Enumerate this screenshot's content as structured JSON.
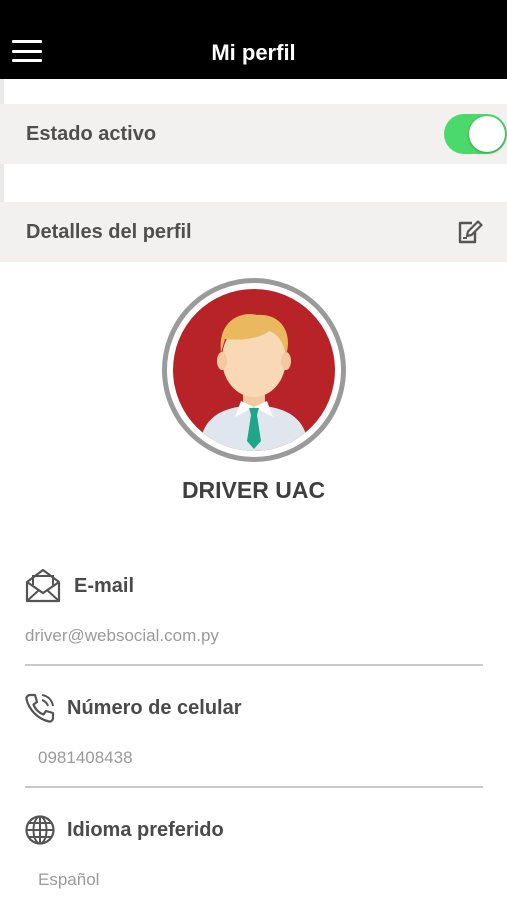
{
  "header": {
    "title": "Mi perfil",
    "menu_icon": "hamburger-icon"
  },
  "status": {
    "label": "Estado activo",
    "active": true,
    "toggle_color": "#4cd96b"
  },
  "profile_section": {
    "label": "Detalles del perfil",
    "edit_icon": "edit-icon"
  },
  "user": {
    "name": "DRIVER UAC",
    "avatar_icon": "user-avatar",
    "avatar_bg": "#b82328"
  },
  "fields": [
    {
      "label": "E-mail",
      "value": "driver@websocial.com.py",
      "icon": "envelope-icon"
    },
    {
      "label": "Número de celular",
      "value": "0981408438",
      "icon": "phone-icon"
    },
    {
      "label": "Idioma preferido",
      "value": "Español",
      "icon": "globe-icon"
    }
  ]
}
